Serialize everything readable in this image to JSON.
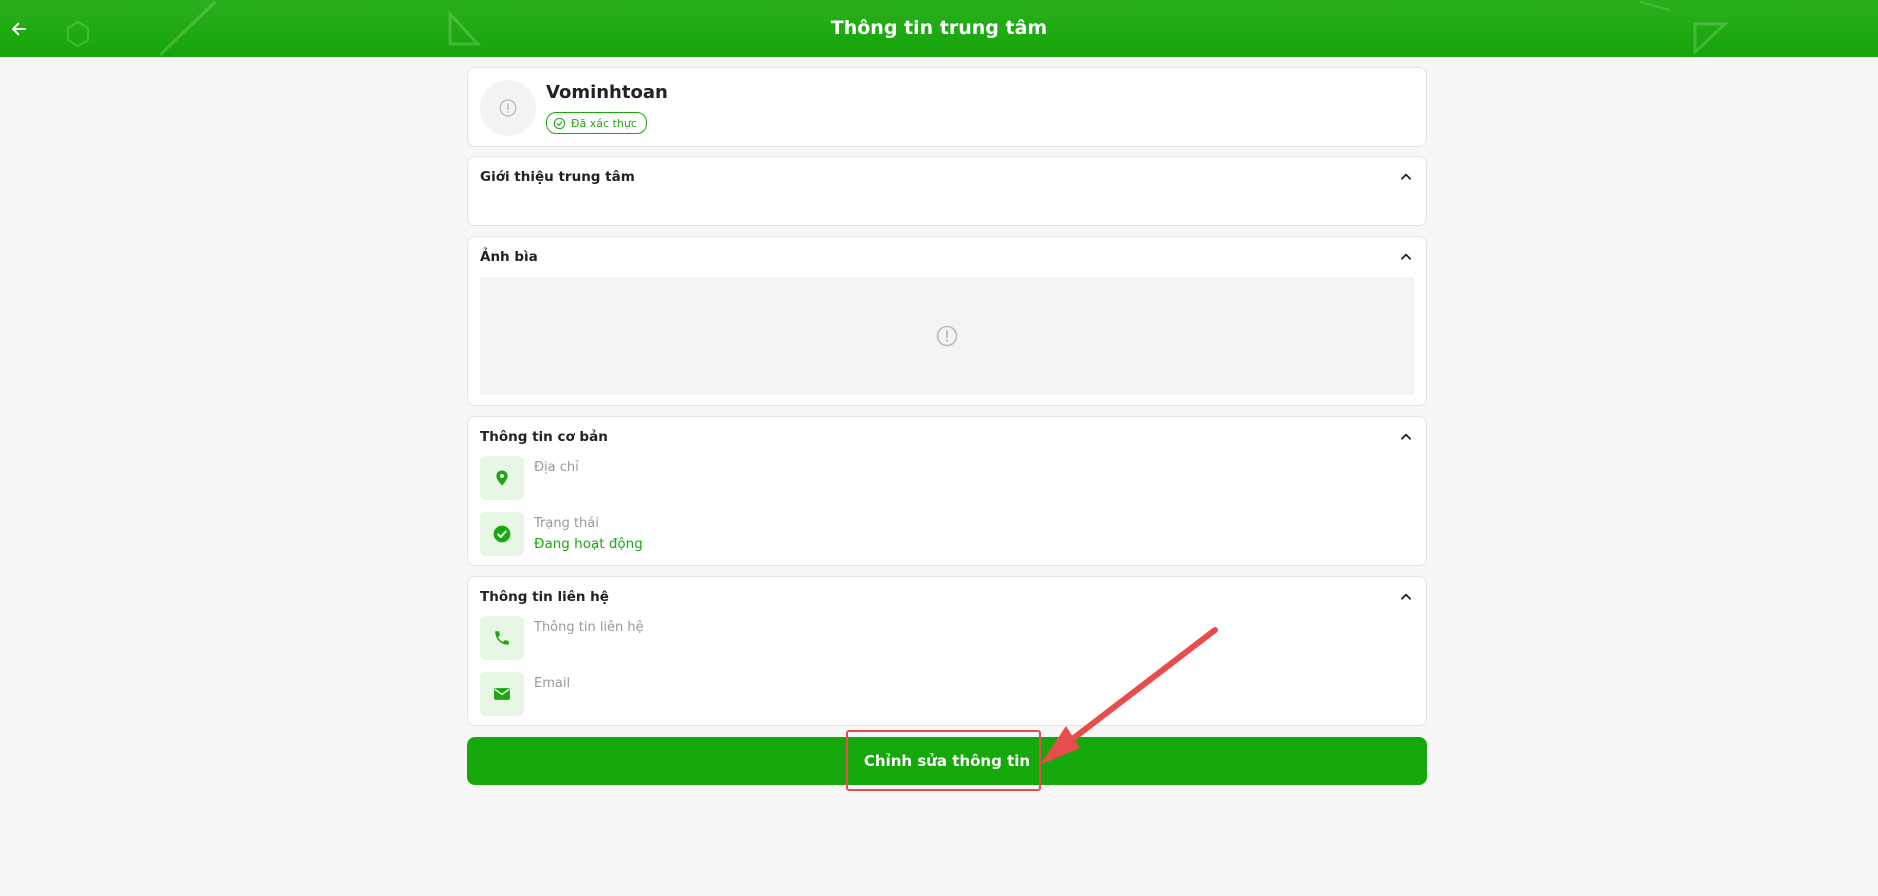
{
  "header": {
    "title": "Thông tin trung tâm",
    "back_icon": "arrow-left-icon",
    "color": "#16a40a"
  },
  "profile": {
    "name": "Vominhtoan",
    "verified_label": "Đã xác thực",
    "avatar_icon": "alert-circle-icon"
  },
  "sections": {
    "intro": {
      "title": "Giới thiệu trung tâm"
    },
    "cover": {
      "title": "Ảnh bìa"
    },
    "basic": {
      "title": "Thông tin cơ bản",
      "address_label": "Địa chỉ",
      "status_label": "Trạng thái",
      "status_value": "Đang hoạt động"
    },
    "contact": {
      "title": "Thông tin liên hệ",
      "contact_label": "Thông tin liên hệ",
      "email_label": "Email"
    }
  },
  "actions": {
    "edit_label": "Chỉnh sửa thông tin"
  },
  "colors": {
    "accent": "#14a80a",
    "annotation": "#e84c4c"
  }
}
